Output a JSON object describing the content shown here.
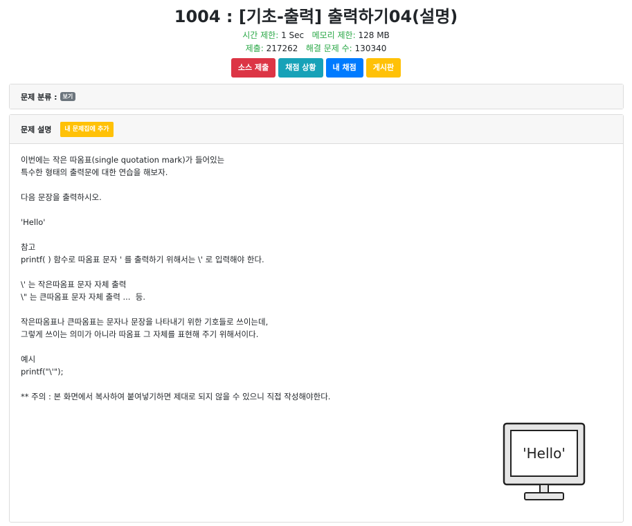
{
  "problem": {
    "title": "1004 : [기초-출력] 출력하기04(설명)",
    "time_limit_label": "시간 제한:",
    "time_limit_value": "1 Sec",
    "memory_limit_label": "메모리 제한:",
    "memory_limit_value": "128 MB",
    "submissions_label": "제출:",
    "submissions_value": "217262",
    "solved_label": "해결 문제 수:",
    "solved_value": "130340"
  },
  "buttons": {
    "submit": "소스 제출",
    "status": "채점 상황",
    "my_status": "내 채점",
    "board": "게시판"
  },
  "category": {
    "label": "문제 분류 :",
    "badge": "보기"
  },
  "description": {
    "label": "문제 설명",
    "add_button": "내 문제집에 추가",
    "lines": [
      "이번에는 작은 따옴표(single quotation mark)가 들어있는",
      "특수한 형태의 출력문에 대한 연습을 해보자.",
      "",
      "다음 문장을 출력하시오.",
      "",
      "'Hello'",
      "",
      "참고",
      "printf( ) 함수로 따옴표 문자 ' 를 출력하기 위해서는 \\' 로 입력해야 한다.",
      "",
      "\\' 는 작은따옴표 문자 자체 출력",
      "\\\" 는 큰따옴표 문자 자체 출력 ...  등.",
      "",
      "작은따옴표나 큰따옴표는 문자나 문장을 나타내기 위한 기호들로 쓰이는데,",
      "그렇게 쓰이는 의미가 아니라 따옴표 그 자체를 표현해 주기 위해서이다.",
      "",
      "예시",
      "printf(\"\\'\");",
      "",
      "** 주의 : 본 화면에서 복사하여 붙여넣기하면 제대로 되지 않을 수 있으니 직접 작성해야한다."
    ]
  },
  "illustration": {
    "monitor_text": "'Hello'"
  }
}
